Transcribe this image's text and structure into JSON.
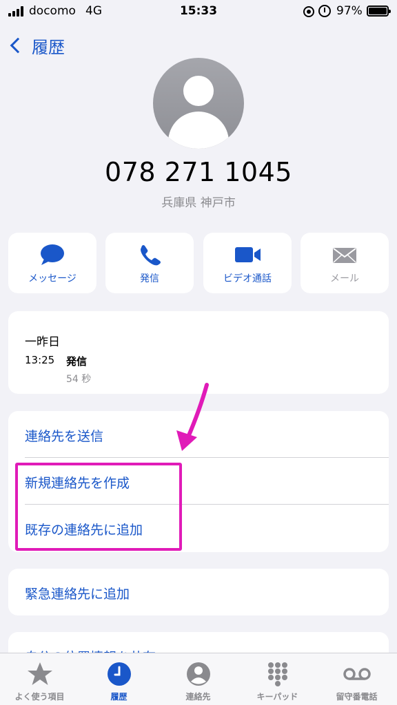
{
  "status_bar": {
    "carrier": "docomo",
    "network": "4G",
    "time": "15:33",
    "battery": "97%"
  },
  "nav": {
    "back_label": "履歴"
  },
  "contact": {
    "number": "078 271 1045",
    "location": "兵庫県 神戸市"
  },
  "actions": [
    {
      "label": "メッセージ",
      "icon": "message-bubble-icon",
      "enabled": true
    },
    {
      "label": "発信",
      "icon": "phone-icon",
      "enabled": true
    },
    {
      "label": "ビデオ通話",
      "icon": "video-camera-icon",
      "enabled": true
    },
    {
      "label": "メール",
      "icon": "envelope-icon",
      "enabled": false
    }
  ],
  "history": {
    "date": "一昨日",
    "time": "13:25",
    "type": "発信",
    "duration": "54 秒"
  },
  "options": [
    {
      "label": "連絡先を送信"
    },
    {
      "label": "新規連絡先を作成"
    },
    {
      "label": "既存の連絡先に追加"
    }
  ],
  "emergency": {
    "label": "緊急連絡先に追加"
  },
  "location_share": {
    "label": "自分の位置情報を共有"
  },
  "tabs": [
    {
      "label": "よく使う項目",
      "icon": "star-icon",
      "active": false
    },
    {
      "label": "履歴",
      "icon": "clock-icon",
      "active": true
    },
    {
      "label": "連絡先",
      "icon": "person-circle-icon",
      "active": false
    },
    {
      "label": "キーパッド",
      "icon": "keypad-icon",
      "active": false
    },
    {
      "label": "留守番電話",
      "icon": "voicemail-icon",
      "active": false
    }
  ],
  "colors": {
    "accent": "#1a57c9",
    "background": "#f2f2f7",
    "annotation": "#e01bb8",
    "disabled": "#9a9aa0"
  }
}
